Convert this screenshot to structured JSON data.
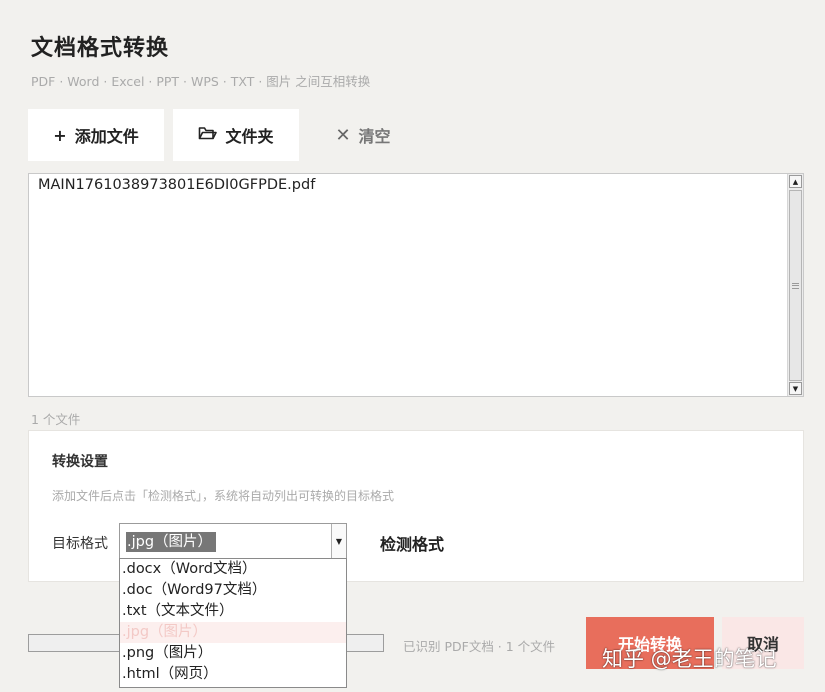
{
  "header": {
    "title": "文档格式转换",
    "subtitle": "PDF · Word · Excel · PPT · WPS · TXT · 图片 之间互相转换"
  },
  "toolbar": {
    "add_file": {
      "icon": "+",
      "label": "添加文件"
    },
    "folder": {
      "icon": "folder-icon",
      "label": "文件夹"
    },
    "clear": {
      "icon": "✕",
      "label": "清空"
    }
  },
  "file_list": {
    "items": [
      "MAIN1761038973801E6DI0GFPDE.pdf"
    ],
    "count_text": "1 个文件"
  },
  "settings": {
    "title": "转换设置",
    "hint": "添加文件后点击「检测格式」，系统将自动列出可转换的目标格式",
    "target_label": "目标格式",
    "selected": ".jpg（图片）",
    "detect_label": "检测格式",
    "options": [
      ".docx（Word文档）",
      ".doc（Word97文档）",
      ".txt（文本文件）",
      ".jpg（图片）",
      ".png（图片）",
      ".html（网页）"
    ],
    "highlighted_index": 3
  },
  "footer": {
    "status": "已识别 PDF文档 · 1 个文件",
    "start_label": "开始转换",
    "cancel_label": "取消",
    "progress": 0
  },
  "watermark": "知乎 @老王的笔记",
  "colors": {
    "background": "#f2f1ee",
    "primary": "#e86e5c",
    "cancel_bg": "#fae7e6"
  }
}
